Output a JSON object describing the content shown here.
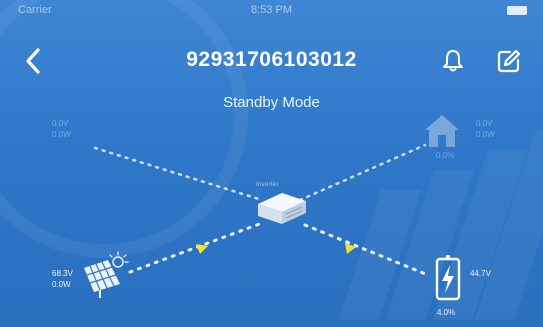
{
  "status_bar": {
    "carrier": "Carrier",
    "time": "8:53 PM"
  },
  "header": {
    "title": "92931706103012",
    "mode": "Standby Mode"
  },
  "icons": {
    "back": "chevron-left-icon",
    "bell": "bell-icon",
    "edit": "edit-icon",
    "solar": "solar-panel-icon",
    "inverter": "inverter-icon",
    "battery": "battery-charging-icon",
    "home": "home-icon"
  },
  "flow": {
    "inverter_label": "Inverter",
    "solar": {
      "voltage": "68.3V",
      "power": "0.0W"
    },
    "battery": {
      "voltage": "44.7V",
      "percent": "4.0%"
    },
    "grid": {
      "voltage": "0.0V",
      "power": "0.0W"
    },
    "load": {
      "voltage": "0.0V",
      "power": "0.0W",
      "percent": "0.0%"
    }
  },
  "colors": {
    "background": "#3a80cf",
    "arrow": "#f2e23a",
    "line": "#ffffff"
  }
}
